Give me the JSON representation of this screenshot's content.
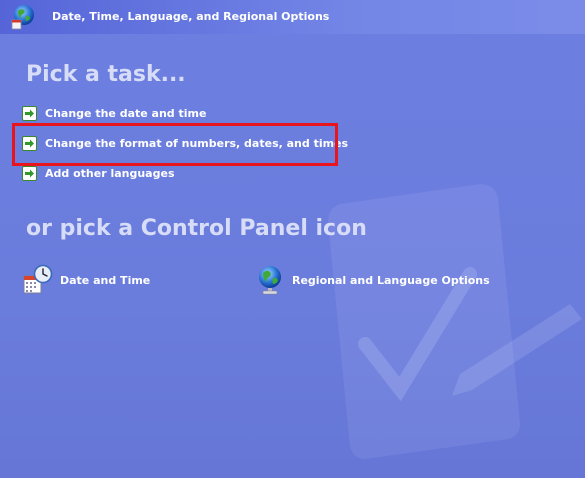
{
  "header": {
    "title": "Date, Time, Language, and Regional Options",
    "icon": "globe-icon"
  },
  "main": {
    "pick_task_heading": "Pick a task...",
    "tasks": [
      {
        "label": "Change the date and time",
        "icon": "green-arrow-icon"
      },
      {
        "label": "Change the format of numbers, dates, and times",
        "icon": "green-arrow-icon"
      },
      {
        "label": "Add other languages",
        "icon": "green-arrow-icon"
      }
    ],
    "control_panel_heading": "or pick a Control Panel icon",
    "control_panel_items": [
      {
        "label": "Date and Time",
        "icon": "calendar-clock-icon"
      },
      {
        "label": "Regional and Language Options",
        "icon": "globe-icon"
      }
    ]
  },
  "colors": {
    "background": "#6376d6",
    "highlight_border": "#e8141e",
    "heading_text": "#d7dcf7"
  }
}
